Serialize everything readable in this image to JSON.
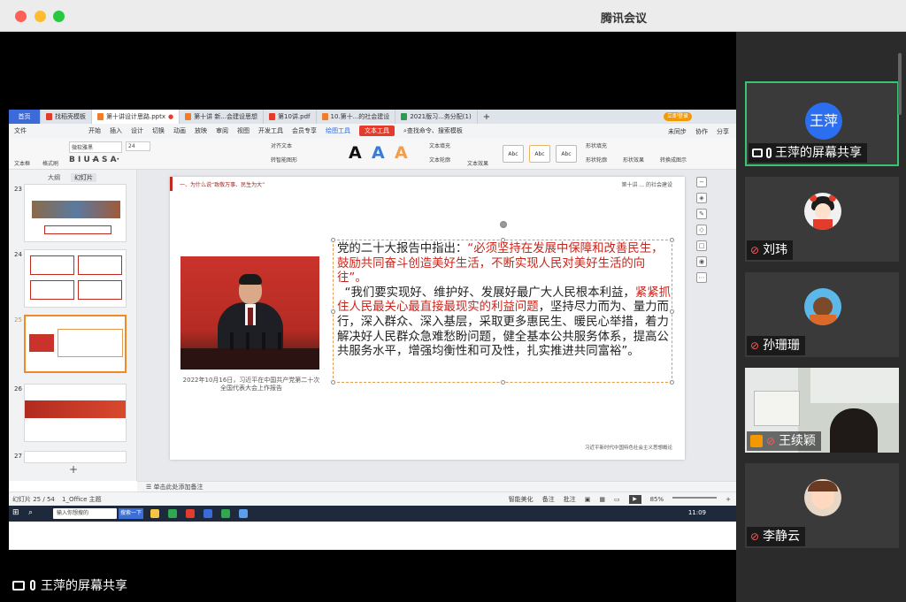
{
  "app_title": "腾讯会议",
  "share_label": "王萍的屏幕共享",
  "wps": {
    "tabs": [
      {
        "label": "首页"
      },
      {
        "label": "找稻壳模板"
      },
      {
        "label": "第十讲设计思路.pptx"
      },
      {
        "label": "第十讲 新...会建设思想"
      },
      {
        "label": "第10讲.pdf"
      },
      {
        "label": "10.第十...的社会建设"
      },
      {
        "label": "2021版习...务分配(1)"
      }
    ],
    "login": "立即登录",
    "menu": [
      "文件",
      "开始",
      "插入",
      "设计",
      "切换",
      "动画",
      "放映",
      "审阅",
      "视图",
      "开发工具",
      "会员专享",
      "绘图工具",
      "文本工具"
    ],
    "menu_search": "查找命令、搜索模板",
    "menu_right": [
      "未同步",
      "协作",
      "分享"
    ],
    "ribbon": {
      "textbox": "文本框",
      "format_painter": "格式刷",
      "font_name": "微软雅黑",
      "font_size": "24",
      "align_text": "对齐文本",
      "smartart": "转智能图形",
      "text_fill": "文本填充",
      "text_outline": "文本轮廓",
      "text_effect": "文本效果",
      "abc": "Abc",
      "shape_fill": "形状填充",
      "shape_outline": "形状轮廓",
      "shape_effect": "形状效果",
      "convert": "转换成图示"
    },
    "left_tabs": [
      "大纲",
      "幻灯片"
    ],
    "thumb_numbers": [
      "23",
      "24",
      "25",
      "26",
      "27"
    ],
    "notes_placeholder": "单击此处添加备注",
    "status": {
      "slide_pos": "幻灯片 25 / 54",
      "theme": "1_Office 主题",
      "smart": "智能美化",
      "notes": "备注",
      "comments": "批注",
      "zoom": "85%"
    },
    "taskbar": {
      "search": "输入你想搜的",
      "search_btn": "搜索一下",
      "time": "11:09"
    }
  },
  "slide": {
    "crumb": "一、为什么说“致敬万事、民生为大”",
    "top_right": "第十讲 ... 的社会建设",
    "paragraph1_prefix": "党的二十大报告中指出：",
    "paragraph1_red": "“必须坚持在发展中保障和改善民生，鼓励共同奋斗创造美好生活，不断实现人民对美好生活的向往”",
    "paragraph1_end": "。",
    "paragraph2_start": "“我们要实现好、维护好、发展好最广大人民根本利益，",
    "paragraph2_red": "紧紧抓住人民最关心最直接最现实的利益问题",
    "paragraph2_end": "，坚持尽力而为、量力而行，深入群众、深入基层，采取更多惠民生、暖民心举措，着力解决好人民群众急难愁盼问题，健全基本公共服务体系，提高公共服务水平，增强均衡性和可及性，扎实推进共同富裕”。",
    "caption": "2022年10月16日，习近平在中国共产党第二十次全国代表大会上作报告",
    "footer": "习近平新时代中国特色社会主义思想概论"
  },
  "participants": [
    {
      "name": "王萍的屏幕共享",
      "avatar_text": "王萍",
      "speaking": true
    },
    {
      "name": "刘玮"
    },
    {
      "name": "孙珊珊"
    },
    {
      "name": "王续颖"
    },
    {
      "name": "李静云"
    }
  ],
  "colors": {
    "accent_red": "#c8261d",
    "speaking_green": "#3bc470",
    "avatar_blue": "#2b6ff0"
  }
}
